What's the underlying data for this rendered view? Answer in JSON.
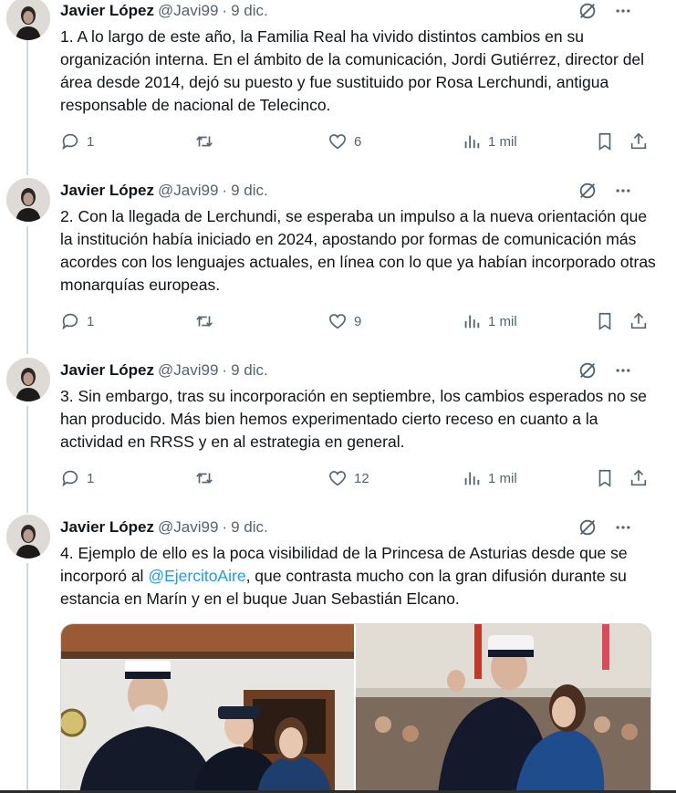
{
  "tweets": [
    {
      "author_name": "Javier López",
      "handle": "@Javi99",
      "separator": "·",
      "date": "9 dic.",
      "text": "1. A lo largo de este año, la Familia Real ha vivido distintos cambios en su organización interna. En el ámbito de la comunicación, Jordi Gutiérrez, director del área desde 2014, dejó su puesto y fue sustituido por Rosa Lerchundi, antigua responsable de nacional de Telecinco.",
      "replies": "1",
      "retweets": "",
      "likes": "6",
      "views": "1 mil"
    },
    {
      "author_name": "Javier López",
      "handle": "@Javi99",
      "separator": "·",
      "date": "9 dic.",
      "text": "2. Con la llegada de Lerchundi, se esperaba un impulso a la nueva orientación que la institución había iniciado en 2024, apostando por formas de comunicación más acordes con los lenguajes actuales, en línea con lo que ya habían incorporado otras monarquías europeas.",
      "replies": "1",
      "retweets": "",
      "likes": "9",
      "views": "1 mil"
    },
    {
      "author_name": "Javier López",
      "handle": "@Javi99",
      "separator": "·",
      "date": "9 dic.",
      "text": "3. Sin embargo, tras su incorporación en septiembre, los cambios esperados no se han producido. Más bien hemos experimentado cierto receso en cuanto a la actividad en RRSS y en al estrategia en general.",
      "replies": "1",
      "retweets": "",
      "likes": "12",
      "views": "1 mil"
    },
    {
      "author_name": "Javier López",
      "handle": "@Javi99",
      "separator": "·",
      "date": "9 dic.",
      "text_before": "4. Ejemplo de ello es la poca visibilidad de la Princesa de Asturias desde que se incorporó al ",
      "mention": "@EjercitoAire",
      "text_after": ", que contrasta mucho con la gran difusión durante su estancia en Marín y en el buque Juan Sebastián Elcano."
    }
  ],
  "icons": {
    "reply": "speech-bubble-icon",
    "retweet": "retweet-icon",
    "like": "heart-icon",
    "views": "bar-chart-icon",
    "bookmark": "bookmark-icon",
    "share": "share-icon",
    "grok": "grok-icon",
    "more": "more-dots-icon"
  },
  "colors": {
    "text": "#0f1419",
    "secondary": "#536471",
    "link": "#1d9bf0",
    "thread_line": "#cfd9de"
  }
}
